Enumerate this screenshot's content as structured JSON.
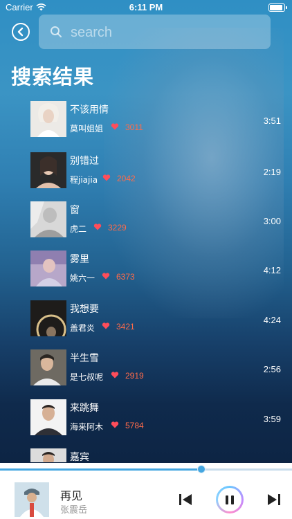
{
  "status_bar": {
    "carrier": "Carrier",
    "time": "6:11 PM"
  },
  "search": {
    "placeholder": "search",
    "value": ""
  },
  "page": {
    "title": "搜索结果"
  },
  "results": [
    {
      "title": "不该用情",
      "artist": "莫叫姐姐",
      "likes": "3011",
      "duration": "3:51"
    },
    {
      "title": "别错过",
      "artist": "程jiajia",
      "likes": "2042",
      "duration": "2:19"
    },
    {
      "title": "窗",
      "artist": "虎二",
      "likes": "3229",
      "duration": "3:00"
    },
    {
      "title": "雾里",
      "artist": "姚六一",
      "likes": "6373",
      "duration": "4:12"
    },
    {
      "title": "我想要",
      "artist": "盖君炎",
      "likes": "3421",
      "duration": "4:24"
    },
    {
      "title": "半生雪",
      "artist": "是七叔呢",
      "likes": "2919",
      "duration": "2:56"
    },
    {
      "title": "来跳舞",
      "artist": "海来阿木",
      "likes": "5784",
      "duration": "3:59"
    },
    {
      "title": "嘉宾",
      "artist": "",
      "likes": "",
      "duration": ""
    }
  ],
  "player": {
    "title": "再见",
    "artist": "张震岳",
    "progress": 0.69
  },
  "colors": {
    "accent": "#44a6e0",
    "likes": "#ff6b4a",
    "heart": "#ff4d5a"
  }
}
